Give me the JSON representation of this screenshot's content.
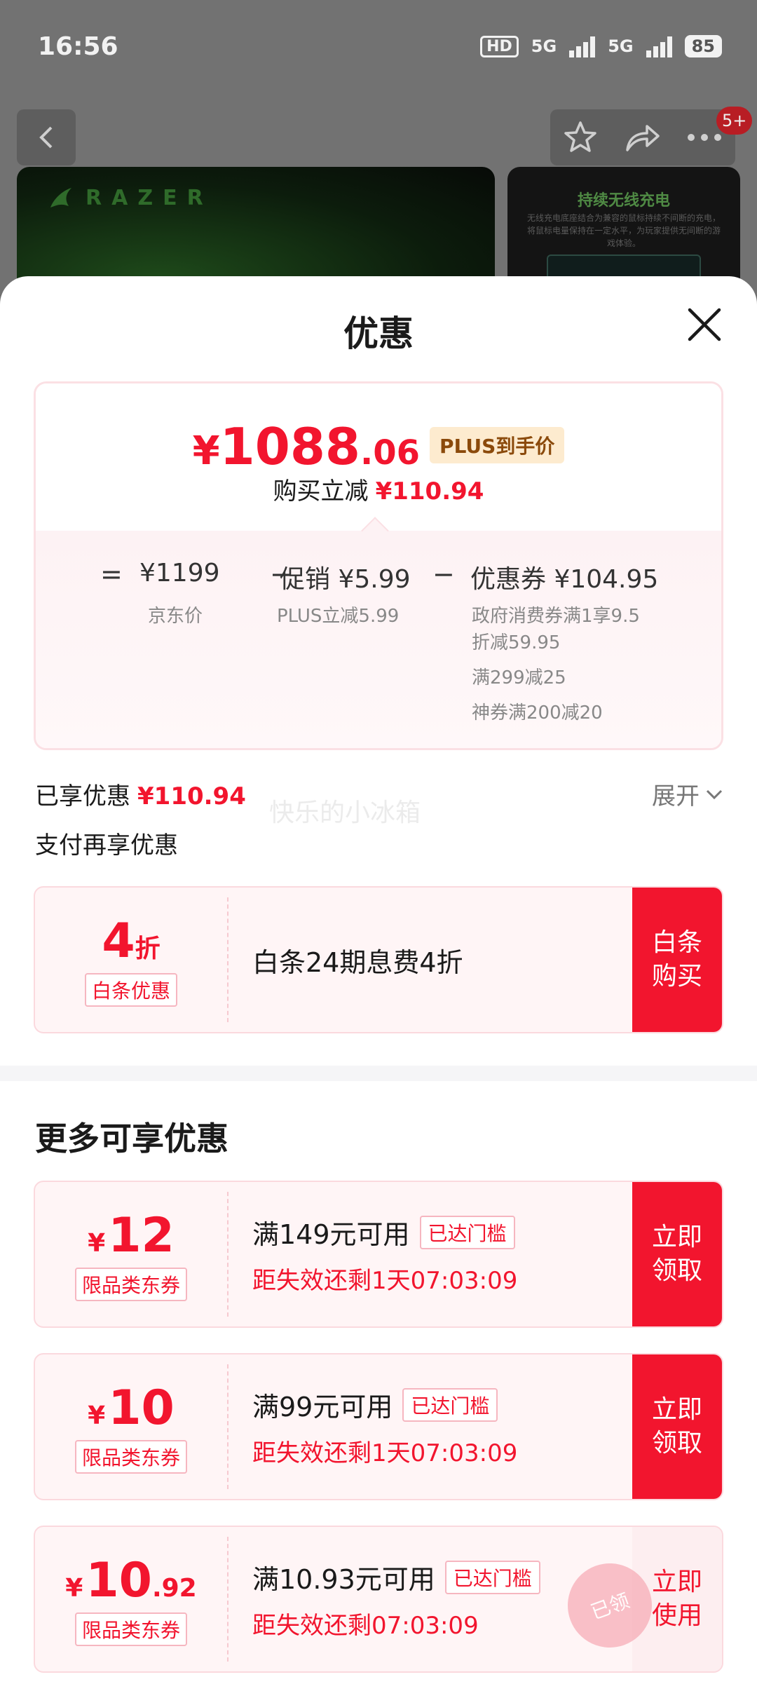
{
  "status_bar": {
    "time": "16:56",
    "hd": "HD",
    "net1": "5G",
    "net2": "5G",
    "battery": "85"
  },
  "nav": {
    "badge": "5+"
  },
  "background": {
    "brand": "RAZER",
    "panel_title": "持续无线充电",
    "panel_text": "无线充电底座结合为兼容的鼠标持续不间断的充电，将鼠标电量保持在一定水平，为玩家提供无间断的游戏体验。"
  },
  "sheet": {
    "title": "优惠"
  },
  "price": {
    "yen": "¥",
    "integer": "1088",
    "decimal": ".06",
    "plus_tag": "PLUS到手价",
    "reduce_label": "购买立减",
    "reduce_amount": "¥110.94"
  },
  "breakdown": {
    "eq": "=",
    "minus1": "−",
    "minus2": "−",
    "jd_price": "¥1199",
    "jd_price_label": "京东价",
    "promo": "促销 ¥5.99",
    "promo_label": "PLUS立减5.99",
    "coupon": "优惠券 ¥104.95",
    "coupon_line1": "政府消费券满1享9.5",
    "coupon_line2": "折减59.95",
    "coupon_line3": "满299减25",
    "coupon_line4": "神券满200减20"
  },
  "enjoyed": {
    "label": "已享优惠",
    "amount": "¥110.94",
    "expand": "展开"
  },
  "watermark": "快乐的小冰箱",
  "pay_more": "支付再享优惠",
  "baitiao": {
    "discount_num": "4",
    "discount_unit": "折",
    "tag": "白条优惠",
    "desc": "白条24期息费4折",
    "button_line1": "白条",
    "button_line2": "购买"
  },
  "more_title": "更多可享优惠",
  "coupons": [
    {
      "yen": "¥",
      "num": "12",
      "dec": "",
      "tag": "限品类东券",
      "cond": "满149元可用",
      "cond_tag": "已达门槛",
      "expire": "距失效还剩1天07:03:09",
      "btn1": "立即",
      "btn2": "领取"
    },
    {
      "yen": "¥",
      "num": "10",
      "dec": "",
      "tag": "限品类东券",
      "cond": "满99元可用",
      "cond_tag": "已达门槛",
      "expire": "距失效还剩1天07:03:09",
      "btn1": "立即",
      "btn2": "领取"
    },
    {
      "yen": "¥",
      "num": "10",
      "dec": ".92",
      "tag": "限品类东券",
      "cond": "满10.93元可用",
      "cond_tag": "已达门槛",
      "expire": "距失效还剩07:03:09",
      "btn1": "立即",
      "btn2": "使用"
    }
  ],
  "stamp": "已领",
  "colors": {
    "accent": "#f2152e",
    "plus_bg": "#fdebcf",
    "plus_text": "#8b4a0b"
  }
}
